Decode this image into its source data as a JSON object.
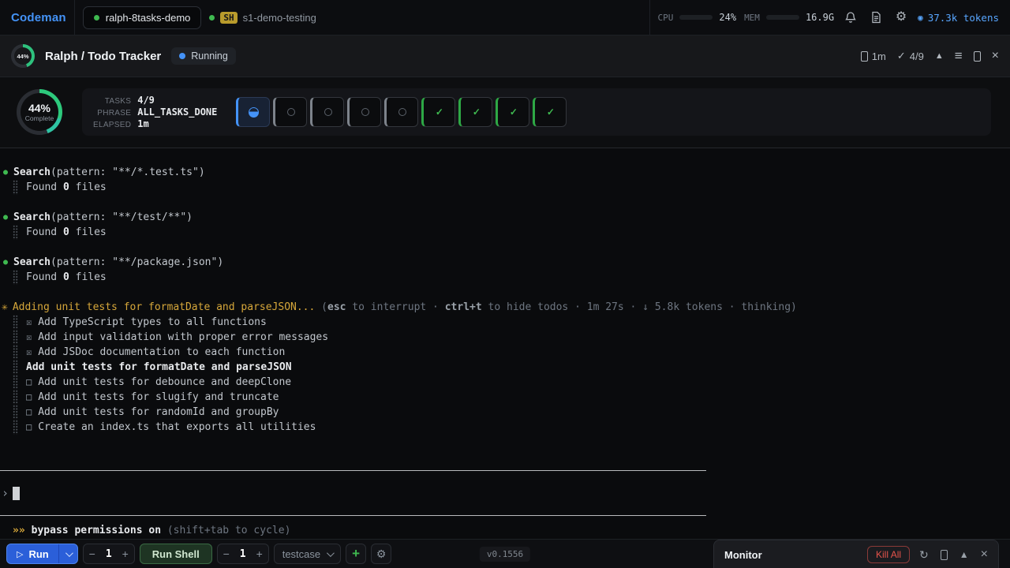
{
  "topbar": {
    "brand": "Codeman",
    "tab_label": "ralph-8tasks-demo",
    "sh_badge": "SH",
    "sh_label": "s1-demo-testing",
    "cpu_label": "CPU",
    "cpu_value": "24%",
    "cpu_pct": 24,
    "mem_label": "MEM",
    "mem_value": "16.9G",
    "mem_pct": 52,
    "tokens_icon": "◉",
    "tokens_label": "37.3k tokens"
  },
  "header": {
    "pct": "44%",
    "title": "Ralph / Todo Tracker",
    "status": "Running",
    "elapsed": "1m",
    "check": "✓",
    "ratio": "4/9",
    "collapse_icon": "▲",
    "menu_icon": "≡",
    "close_icon": "×"
  },
  "progress": {
    "pct": "44%",
    "sub": "Complete",
    "stats": [
      {
        "label": "TASKS",
        "value": "4/9"
      },
      {
        "label": "PHRASE",
        "value": "ALL_TASKS_DONE"
      },
      {
        "label": "ELAPSED",
        "value": "1m"
      }
    ],
    "chips": [
      "active",
      "pending",
      "pending",
      "pending",
      "pending",
      "done",
      "done",
      "done",
      "done"
    ],
    "chip_check": "✓"
  },
  "terminal": {
    "bullet": "●",
    "searches": [
      {
        "tool": "Search",
        "args": "(pattern: \"**/*.test.ts\")",
        "found_pre": "Found ",
        "found_count": "0",
        "found_post": " files"
      },
      {
        "tool": "Search",
        "args": "(pattern: \"**/test/**\")",
        "found_pre": "Found ",
        "found_count": "0",
        "found_post": " files"
      },
      {
        "tool": "Search",
        "args": "(pattern: \"**/package.json\")",
        "found_pre": "Found ",
        "found_count": "0",
        "found_post": " files"
      }
    ],
    "activity": {
      "star": "✳",
      "text": "Adding unit tests for formatDate and parseJSON... ",
      "hint": [
        {
          "t": "(",
          "b": 0
        },
        {
          "t": "esc",
          "b": 1
        },
        {
          "t": " to interrupt · ",
          "b": 0
        },
        {
          "t": "ctrl+t",
          "b": 1
        },
        {
          "t": " to hide todos · 1m 27s · ↓ 5.8k tokens · thinking)",
          "b": 0
        }
      ]
    },
    "todo_icons": {
      "done": "☒",
      "open": "□"
    },
    "todos": [
      {
        "state": "done",
        "text": "Add TypeScript types to all functions"
      },
      {
        "state": "done",
        "text": "Add input validation with proper error messages"
      },
      {
        "state": "done",
        "text": "Add JSDoc documentation to each function"
      },
      {
        "state": "active",
        "text": "Add unit tests for formatDate and parseJSON"
      },
      {
        "state": "open",
        "text": "Add unit tests for debounce and deepClone"
      },
      {
        "state": "open",
        "text": "Add unit tests for slugify and truncate"
      },
      {
        "state": "open",
        "text": "Add unit tests for randomId and groupBy"
      },
      {
        "state": "open",
        "text": "Create an index.ts that exports all utilities"
      }
    ],
    "prompt_char": "›",
    "mode": {
      "arrows": "»»",
      "label": "bypass permissions on",
      "hint": "(shift+tab to cycle)"
    }
  },
  "bottombar": {
    "run_label": "Run",
    "play_icon": "▷",
    "minus": "−",
    "plus": "+",
    "run_count": "1",
    "shell_label": "Run Shell",
    "shell_count": "1",
    "testcase_label": "testcase",
    "add_label": "+",
    "gear_icon": "⚙",
    "version": "v0.1556"
  },
  "monitor": {
    "title": "Monitor",
    "kill_all": "Kill All",
    "refresh_icon": "↻",
    "collapse_icon": "▲",
    "close_icon": "×"
  }
}
